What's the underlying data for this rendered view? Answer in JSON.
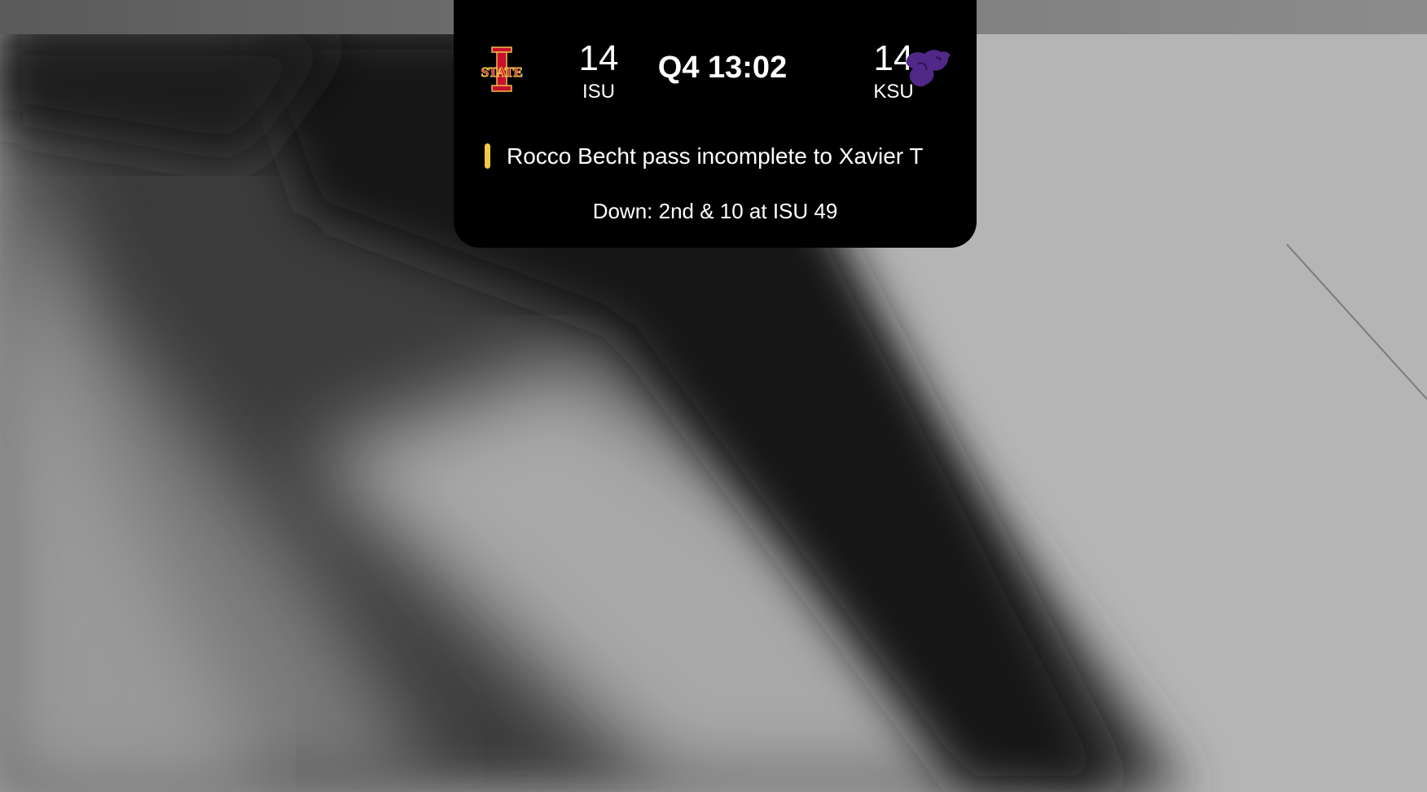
{
  "scoreboard": {
    "home": {
      "score": "14",
      "abbr": "ISU",
      "logo_icon": "iowa-state-cyclones-logo-icon",
      "logo_colors": {
        "primary": "#C8102E",
        "secondary": "#F1BE48"
      }
    },
    "away": {
      "score": "14",
      "abbr": "KSU",
      "logo_icon": "kansas-state-wildcat-logo-icon",
      "logo_colors": {
        "primary": "#512888"
      }
    },
    "clock": "Q4 13:02",
    "last_play": "Rocco Becht pass incomplete to Xavier T",
    "down": "Down: 2nd & 10 at ISU 49",
    "play_indicator_color": "#F2C94C"
  }
}
